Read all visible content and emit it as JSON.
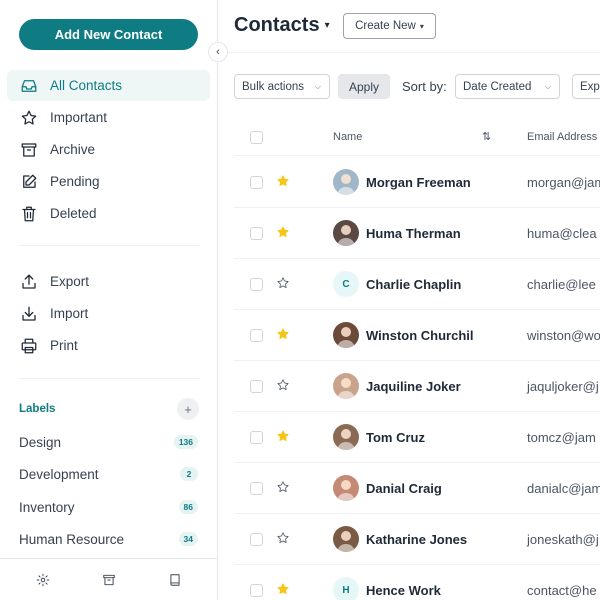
{
  "sidebar": {
    "add_button": "Add New Contact",
    "nav": [
      {
        "label": "All Contacts",
        "icon": "inbox-icon",
        "active": true
      },
      {
        "label": "Important",
        "icon": "star-icon",
        "active": false
      },
      {
        "label": "Archive",
        "icon": "archive-icon",
        "active": false
      },
      {
        "label": "Pending",
        "icon": "edit-icon",
        "active": false
      },
      {
        "label": "Deleted",
        "icon": "trash-icon",
        "active": false
      }
    ],
    "actions": [
      {
        "label": "Export",
        "icon": "export-icon"
      },
      {
        "label": "Import",
        "icon": "import-icon"
      },
      {
        "label": "Print",
        "icon": "printer-icon"
      }
    ],
    "labels_title": "Labels",
    "labels": [
      {
        "name": "Design",
        "count": "136"
      },
      {
        "name": "Development",
        "count": "2"
      },
      {
        "name": "Inventory",
        "count": "86"
      },
      {
        "name": "Human Resource",
        "count": "34"
      }
    ],
    "footer_icons": [
      "gear-icon",
      "archive-icon",
      "book-icon"
    ]
  },
  "header": {
    "title": "Contacts",
    "create_new": "Create New"
  },
  "toolbar": {
    "bulk_actions": "Bulk actions",
    "apply": "Apply",
    "sort_by": "Sort by:",
    "sort_value": "Date Created",
    "export": "Expo"
  },
  "table": {
    "columns": {
      "name": "Name",
      "email": "Email Address"
    },
    "rows": [
      {
        "name": "Morgan Freeman",
        "email": "morgan@jam",
        "starred": true,
        "avatar": "photo",
        "avatar_color": "#9fb7c9"
      },
      {
        "name": "Huma Therman",
        "email": "huma@clea",
        "starred": true,
        "avatar": "photo",
        "avatar_color": "#5b4a42"
      },
      {
        "name": "Charlie Chaplin",
        "email": "charlie@lee",
        "starred": false,
        "avatar": "C",
        "avatar_color": "#e6f7f7"
      },
      {
        "name": "Winston Churchil",
        "email": "winston@wo",
        "starred": true,
        "avatar": "photo",
        "avatar_color": "#6b4a3a"
      },
      {
        "name": "Jaquiline Joker",
        "email": "jaquljoker@j",
        "starred": false,
        "avatar": "photo",
        "avatar_color": "#c9a48c"
      },
      {
        "name": "Tom Cruz",
        "email": "tomcz@jam",
        "starred": true,
        "avatar": "photo",
        "avatar_color": "#8a6a55"
      },
      {
        "name": "Danial Craig",
        "email": "danialc@jam",
        "starred": false,
        "avatar": "photo",
        "avatar_color": "#c48a76"
      },
      {
        "name": "Katharine Jones",
        "email": "joneskath@j",
        "starred": false,
        "avatar": "photo",
        "avatar_color": "#7a5a44"
      },
      {
        "name": "Hence Work",
        "email": "contact@he",
        "starred": true,
        "avatar": "H",
        "avatar_color": "#e6f7f7"
      }
    ]
  },
  "colors": {
    "accent": "#0f7b83",
    "star": "#f5c518"
  }
}
